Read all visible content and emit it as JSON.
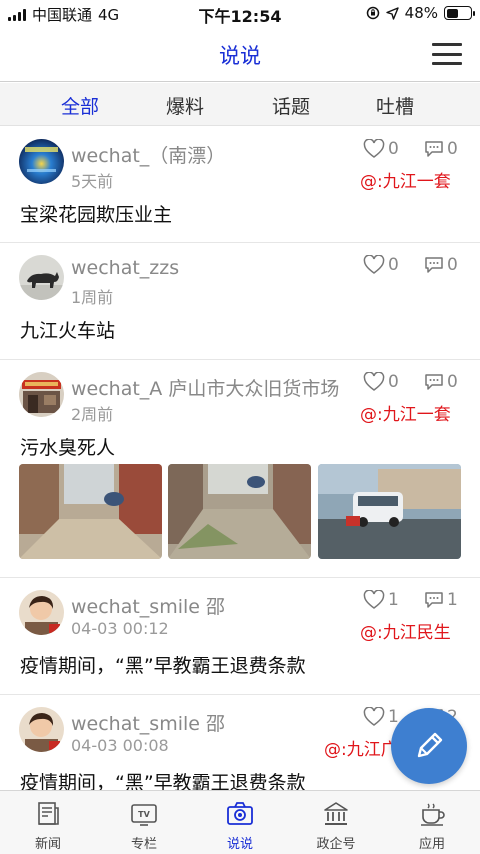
{
  "status_bar": {
    "carrier": "中国联通",
    "network": "4G",
    "time": "下午12:54",
    "battery": "48%",
    "battery_level": 0.48
  },
  "header": {
    "title": "说说",
    "menu_icon": "hamburger-menu-icon"
  },
  "tabs": [
    {
      "label": "全部",
      "active": true
    },
    {
      "label": "爆料",
      "active": false
    },
    {
      "label": "话题",
      "active": false
    },
    {
      "label": "吐槽",
      "active": false
    }
  ],
  "posts": [
    {
      "user": "wechat_（南漂）",
      "time": "5天前",
      "likes": "0",
      "comments": "0",
      "tag": "@:九江一套",
      "text": "宝梁花园欺压业主"
    },
    {
      "user": "wechat_zzs",
      "time": "1周前",
      "likes": "0",
      "comments": "0",
      "tag": "",
      "text": "九江火车站"
    },
    {
      "user": "wechat_A 庐山市大众旧货市场",
      "time": "2周前",
      "likes": "0",
      "comments": "0",
      "tag": "@:九江一套",
      "text": "污水臭死人"
    },
    {
      "user": "wechat_smile 邵",
      "time": "04-03 00:12",
      "likes": "1",
      "comments": "1",
      "tag": "@:九江民生",
      "text": "疫情期间，“黑”早教霸王退费条款"
    },
    {
      "user": "wechat_smile 邵",
      "time": "04-03 00:08",
      "likes": "1",
      "comments": "2",
      "tag": "@:九江广",
      "text": "疫情期间，“黑”早教霸王退费条款"
    }
  ],
  "fab": {
    "icon": "pencil-edit-icon"
  },
  "bottom_nav": [
    {
      "label": "新闻",
      "icon": "newspaper-icon"
    },
    {
      "label": "专栏",
      "icon": "tv-icon"
    },
    {
      "label": "说说",
      "icon": "camera-icon",
      "active": true
    },
    {
      "label": "政企号",
      "icon": "government-building-icon"
    },
    {
      "label": "应用",
      "icon": "coffee-cup-icon"
    }
  ],
  "colors": {
    "accent_blue": "#1a2fd6",
    "tag_red": "#e0161b",
    "fab_blue": "#3e7fd0"
  }
}
